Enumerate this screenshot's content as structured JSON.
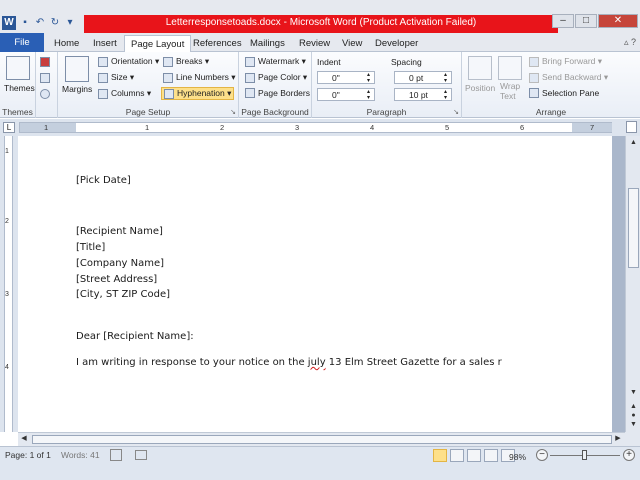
{
  "window": {
    "title": "Letterresponsetoads.docx - Microsoft Word (Product Activation Failed)",
    "app_icon": "W",
    "qat": [
      "save-icon",
      "undo-icon",
      "redo-icon",
      "customize-icon"
    ],
    "controls": {
      "minimize": "–",
      "maximize": "□",
      "close": "✕"
    },
    "title_bar_color": "#e8141a"
  },
  "tabs": {
    "file": "File",
    "items": [
      "Home",
      "Insert",
      "Page Layout",
      "References",
      "Mailings",
      "Review",
      "View",
      "Developer"
    ],
    "active": "Page Layout",
    "controls": "▵ ?"
  },
  "ribbon": {
    "themes": {
      "themes_label": "Themes",
      "group_label": "Themes"
    },
    "page_setup": {
      "margins_label": "Margins",
      "orientation": "Orientation ▾",
      "size": "Size ▾",
      "columns": "Columns ▾",
      "breaks": "Breaks ▾",
      "line_numbers": "Line Numbers ▾",
      "hyphenation": "Hyphenation ▾",
      "group_label": "Page Setup"
    },
    "page_background": {
      "watermark": "Watermark ▾",
      "page_color": "Page Color ▾",
      "page_borders": "Page Borders",
      "group_label": "Page Background"
    },
    "paragraph": {
      "indent_label": "Indent",
      "spacing_label": "Spacing",
      "indent_left": "0\"",
      "indent_right": "0\"",
      "spacing_before": "0 pt",
      "spacing_after": "10 pt",
      "group_label": "Paragraph"
    },
    "arrange": {
      "position": "Position",
      "wrap_text": "Wrap Text",
      "bring_forward": "Bring Forward ▾",
      "send_backward": "Send Backward ▾",
      "selection_pane": "Selection Pane",
      "group_label": "Arrange"
    }
  },
  "ruler": {
    "tab_selector": "L",
    "numbers": [
      "1",
      "1",
      "2",
      "3",
      "4",
      "5",
      "6",
      "7"
    ]
  },
  "vertical_ruler": {
    "numbers": [
      "1",
      "2",
      "3",
      "4"
    ]
  },
  "document": {
    "date": "[Pick Date]",
    "recipient_name": "[Recipient Name]",
    "title": "[Title]",
    "company_name": "[Company Name]",
    "street_address": "[Street Address]",
    "city_state_zip": "[City, ST ZIP Code]",
    "salutation": "Dear [Recipient Name]:",
    "body_before": "I am writing in response to your notice on the ",
    "body_misspelled": "july",
    "body_after": " 13 Elm Street Gazette for a sales r"
  },
  "status": {
    "page": "Page: 1 of 1",
    "words": "Words: 41",
    "zoom": "98%",
    "zoom_out": "−",
    "zoom_in": "+"
  }
}
